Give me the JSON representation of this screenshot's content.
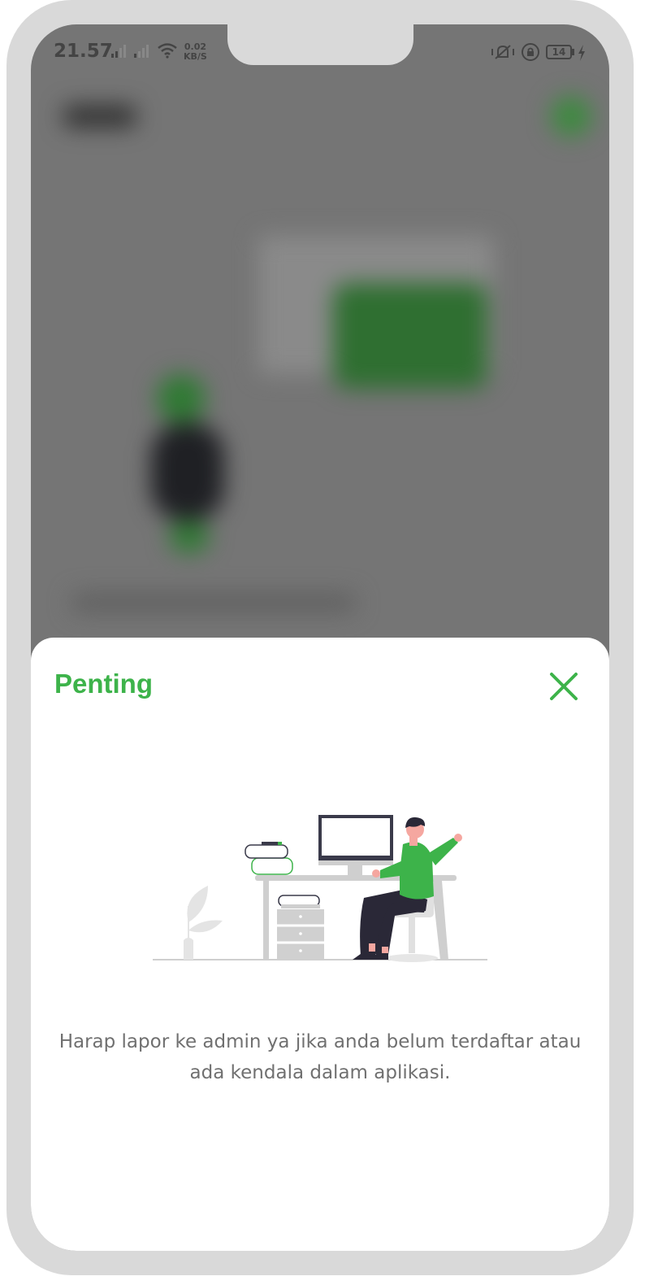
{
  "status_bar": {
    "time": "21.57",
    "net_speed_value": "0.02",
    "net_speed_unit": "KB/S",
    "battery": "14"
  },
  "modal": {
    "title": "Penting",
    "close_icon": "close-icon",
    "message": "Harap lapor ke admin ya jika anda belum terdaftar atau ada kendala dalam aplikasi."
  },
  "colors": {
    "accent": "#3db34a",
    "frame": "#d9d9d9",
    "overlay": "#757575",
    "text_muted": "#707070"
  }
}
